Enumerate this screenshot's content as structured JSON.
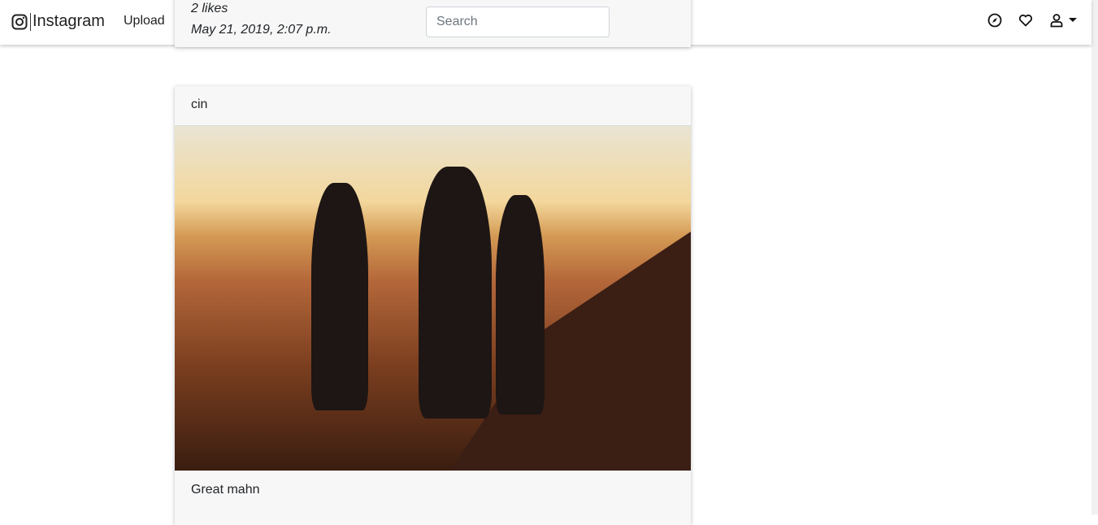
{
  "navbar": {
    "brand": "Instagram",
    "upload_label": "Upload",
    "search_placeholder": "Search"
  },
  "previous_post": {
    "likes": "2 likes",
    "timestamp": "May 21, 2019, 2:07 p.m."
  },
  "post": {
    "username": "cin",
    "caption": "Great mahn"
  }
}
